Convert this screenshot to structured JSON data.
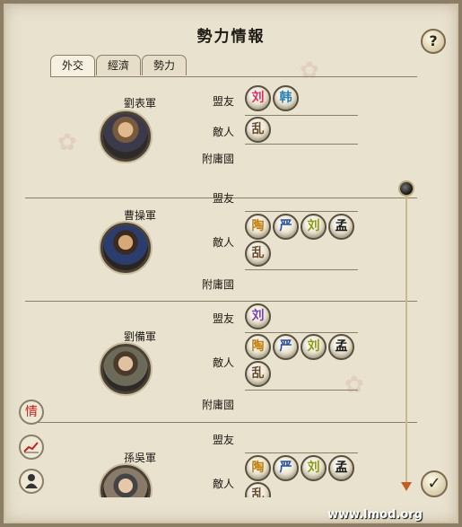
{
  "window": {
    "title": "勢力情報"
  },
  "help_label": "?",
  "ok_label": "✓",
  "tabs": [
    {
      "label": "外交",
      "active": true
    },
    {
      "label": "經濟",
      "active": false
    },
    {
      "label": "勢力",
      "active": false
    }
  ],
  "relation_labels": {
    "ally": "盟友",
    "enemy": "敵人",
    "vassal": "附庸國"
  },
  "forces": [
    {
      "name": "劉表軍",
      "allies": [
        {
          "char": "刘",
          "color": "#e03060"
        },
        {
          "char": "韩",
          "color": "#2a7fb0"
        }
      ],
      "enemies": [
        {
          "char": "乱",
          "color": "#6b4a2a"
        }
      ],
      "vassals": []
    },
    {
      "name": "曹操軍",
      "allies": [],
      "enemies": [
        {
          "char": "陶",
          "color": "#c08010"
        },
        {
          "char": "严",
          "color": "#2850a0"
        },
        {
          "char": "刘",
          "color": "#8a9a10"
        },
        {
          "char": "孟",
          "color": "#1a1a1a"
        },
        {
          "char": "乱",
          "color": "#6b4a2a"
        }
      ],
      "vassals": []
    },
    {
      "name": "劉備軍",
      "allies": [
        {
          "char": "刘",
          "color": "#7a40b0"
        }
      ],
      "enemies": [
        {
          "char": "陶",
          "color": "#c08010"
        },
        {
          "char": "严",
          "color": "#2850a0"
        },
        {
          "char": "刘",
          "color": "#8a9a10"
        },
        {
          "char": "孟",
          "color": "#1a1a1a"
        },
        {
          "char": "乱",
          "color": "#6b4a2a"
        }
      ],
      "vassals": []
    },
    {
      "name": "孫吳軍",
      "allies": [],
      "enemies": [
        {
          "char": "陶",
          "color": "#c08010"
        },
        {
          "char": "严",
          "color": "#2850a0"
        },
        {
          "char": "刘",
          "color": "#8a9a10"
        },
        {
          "char": "孟",
          "color": "#1a1a1a"
        },
        {
          "char": "乱",
          "color": "#6b4a2a"
        }
      ],
      "vassals": []
    }
  ],
  "side_buttons": [
    {
      "label": "情",
      "icon": "intel-icon",
      "color": "#c02020"
    },
    {
      "label": "",
      "icon": "chart-icon",
      "color": "#c02020"
    },
    {
      "label": "",
      "icon": "general-icon",
      "color": "#333333"
    }
  ],
  "footer": "www.lmod.org"
}
